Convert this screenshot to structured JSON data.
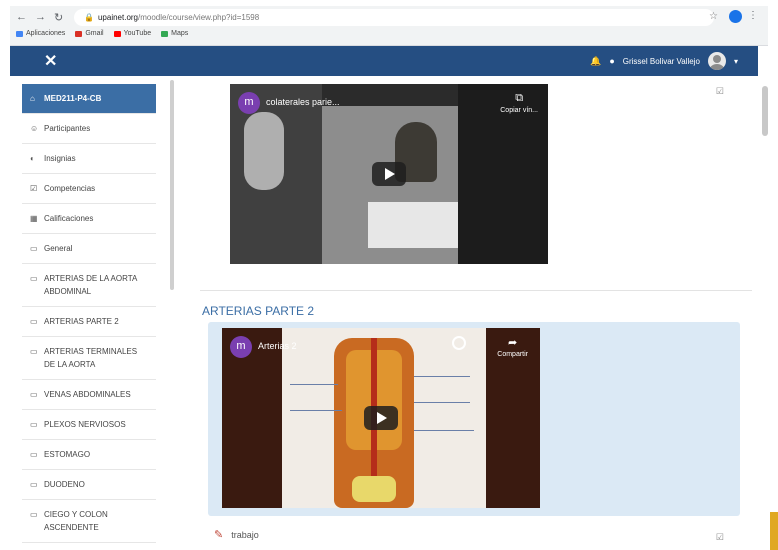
{
  "browser": {
    "url_host": "upainet.org",
    "url_path": "/moodle/course/view.php?id=1598",
    "bookmarks": [
      {
        "label": "Aplicaciones",
        "color": "#4285f4"
      },
      {
        "label": "Gmail",
        "color": "#d93025"
      },
      {
        "label": "YouTube",
        "color": "#ff0000"
      },
      {
        "label": "Maps",
        "color": "#34a853"
      }
    ]
  },
  "navbar": {
    "close_glyph": "✕",
    "user_name": "Grissel Bolivar Vallejo"
  },
  "drawer": {
    "items": [
      {
        "label": "MED211-P4-CB",
        "icon": "⌂",
        "active": true
      },
      {
        "label": "Participantes",
        "icon": "☺"
      },
      {
        "label": "Insignias",
        "icon": "◐"
      },
      {
        "label": "Competencias",
        "icon": "☑"
      },
      {
        "label": "Calificaciones",
        "icon": "▦"
      },
      {
        "label": "General",
        "icon": "▭"
      },
      {
        "label": "ARTERIAS DE LA AORTA ABDOMINAL",
        "icon": "▭"
      },
      {
        "label": "ARTERIAS PARTE 2",
        "icon": "▭"
      },
      {
        "label": "ARTERIAS TERMINALES DE LA AORTA",
        "icon": "▭"
      },
      {
        "label": "VENAS ABDOMINALES",
        "icon": "▭"
      },
      {
        "label": "PLEXOS NERVIOSOS",
        "icon": "▭"
      },
      {
        "label": "ESTOMAGO",
        "icon": "▭"
      },
      {
        "label": "DUODENO",
        "icon": "▭"
      },
      {
        "label": "CIEGO Y COLON ASCENDENTE",
        "icon": "▭"
      }
    ]
  },
  "main": {
    "video1": {
      "logo": "m",
      "title": "colaterales parie...",
      "copy_label": "Copiar vín..."
    },
    "section": {
      "title": "ARTERIAS PARTE 2",
      "video": {
        "logo": "m",
        "title": "Arterias 2",
        "share_label": "Compartir"
      }
    },
    "task": {
      "label": "trabajo"
    }
  }
}
